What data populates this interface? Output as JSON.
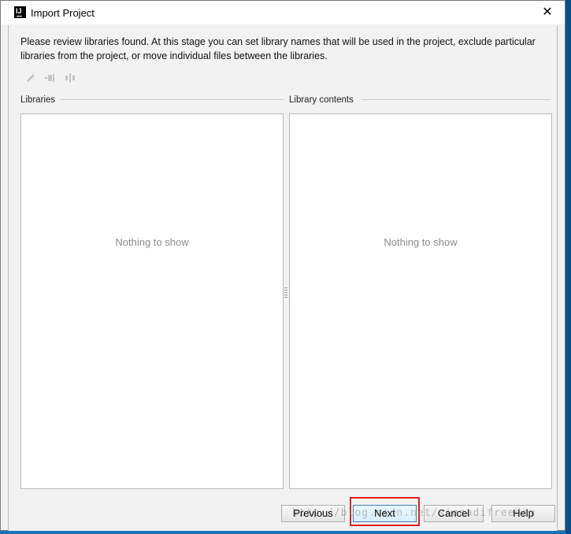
{
  "window": {
    "title": "Import Project",
    "app_icon_text": "IJ",
    "close_glyph": "✕"
  },
  "description": "Please review libraries found. At this stage you can set library names that will be used in the project, exclude particular libraries from the project, or move individual files between the libraries.",
  "toolbar": {
    "icons": [
      "edit-icon",
      "merge-icon",
      "split-icon"
    ]
  },
  "libraries": {
    "label": "Libraries",
    "empty_text": "Nothing to show"
  },
  "library_contents": {
    "label": "Library contents",
    "empty_text": "Nothing to show"
  },
  "buttons": {
    "previous": "Previous",
    "next": "Next",
    "cancel": "Cancel",
    "help": "Help"
  },
  "watermark": "http://blog.csdn.net/sinnadifreedom",
  "colors": {
    "highlight": "#e02020",
    "default_button_border": "#3c7fb1"
  }
}
